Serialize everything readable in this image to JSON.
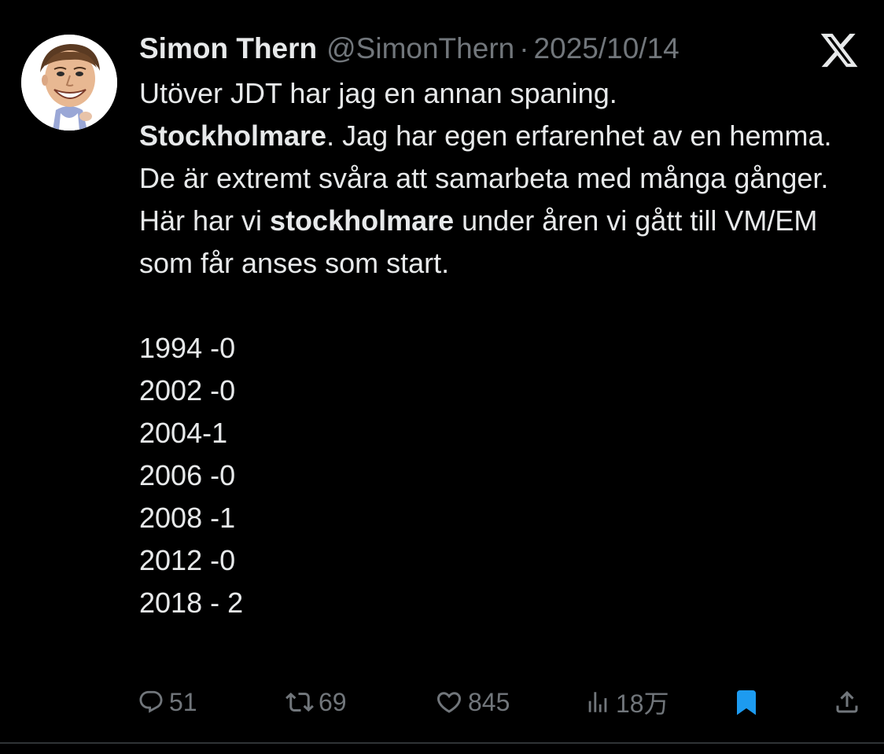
{
  "tweet": {
    "author": {
      "display_name": "Simon Thern",
      "handle": "@SimonThern",
      "separator": "·",
      "date": "2025/10/14"
    },
    "body": {
      "line1": "Utöver JDT har jag en annan spaning.",
      "para2_bold": "Stockholmare",
      "para2_rest": ". Jag har egen erfarenhet av en hemma. De är extremt svåra att samarbeta med många gånger.",
      "para3_start": "Här har vi ",
      "para3_bold": "stockholmare",
      "para3_rest": " under åren vi gått till VM/EM som får anses som start.",
      "list": [
        "1994 -0",
        "2002 -0",
        "2004-1",
        "2006 -0",
        "2008 -1",
        "2012 -0",
        "2018 - 2"
      ]
    },
    "stats": {
      "replies": "51",
      "retweets": "69",
      "likes": "845",
      "views": "18万"
    },
    "icons": {
      "logo": "x-logo-icon",
      "reply": "reply-icon",
      "retweet": "retweet-icon",
      "like": "heart-icon",
      "views": "views-icon",
      "bookmark": "bookmark-icon",
      "share": "share-icon"
    },
    "colors": {
      "background": "#000000",
      "text": "#e7e9ea",
      "muted": "#71767b",
      "bookmark_active": "#1d9bf0",
      "divider": "#2f3336"
    }
  }
}
